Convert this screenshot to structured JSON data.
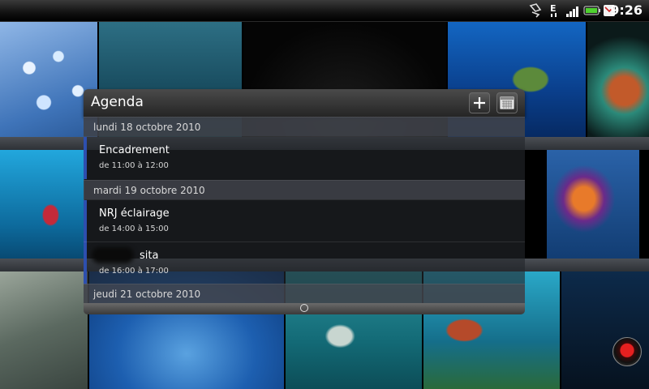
{
  "status_bar": {
    "time": "9:26",
    "icons": [
      "usb-debug-icon",
      "edge-network-icon",
      "signal-strength-icon",
      "battery-icon",
      "gmail-icon"
    ]
  },
  "agenda": {
    "title": "Agenda",
    "add_icon": "plus-icon",
    "calendar_icon": "calendar-icon",
    "days": [
      {
        "date": "lundi 18 octobre 2010",
        "events": [
          {
            "title": "Encadrement",
            "time": "de 11:00 à 12:00"
          }
        ]
      },
      {
        "date": "mardi 19 octobre 2010",
        "events": [
          {
            "title": "NRJ éclairage",
            "time": "de 14:00 à 15:00"
          },
          {
            "title": "sita",
            "time": "de 16:00 à 17:00"
          }
        ]
      },
      {
        "date": "jeudi 21 octobre 2010",
        "events": []
      }
    ]
  },
  "colors": {
    "event_accent": "#2d4fae",
    "record_button": "#e52020"
  }
}
